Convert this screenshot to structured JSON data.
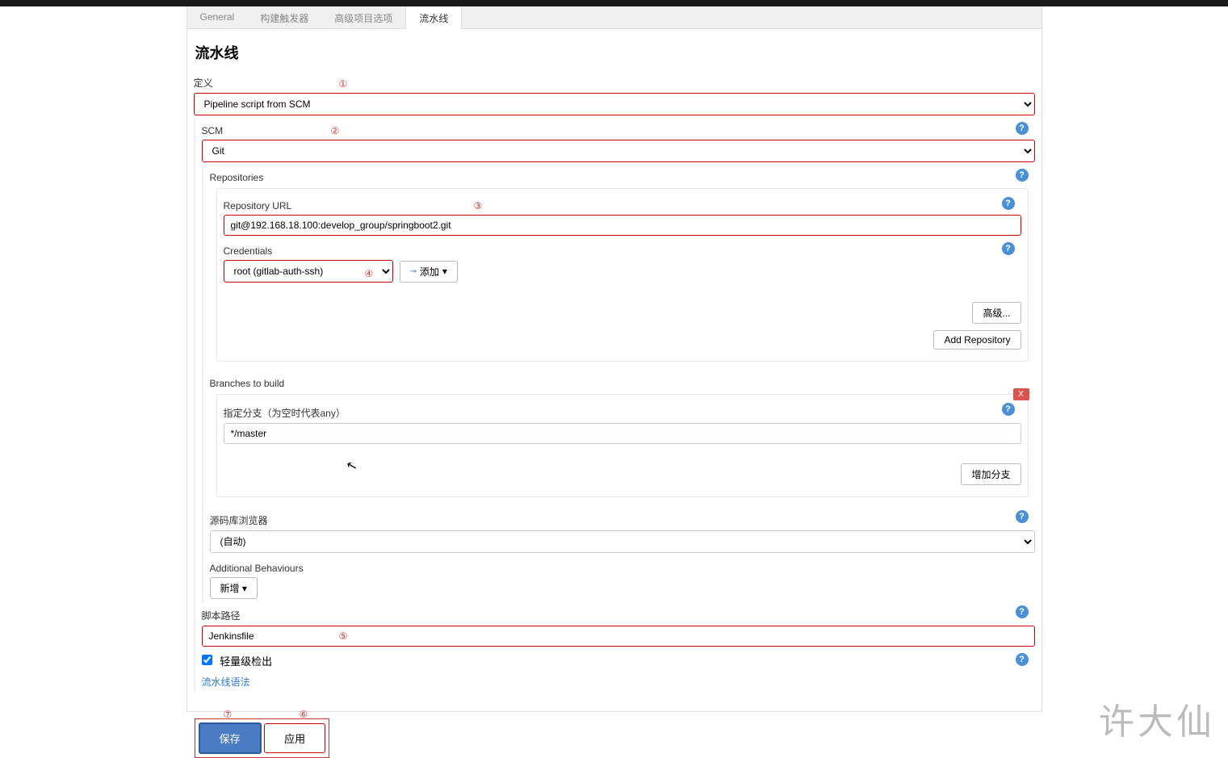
{
  "tabs": {
    "general": "General",
    "triggers": "构建触发器",
    "advanced": "高级项目选项",
    "pipeline": "流水线"
  },
  "section_title": "流水线",
  "annotations": {
    "a1": "①",
    "a2": "②",
    "a3": "③",
    "a4": "④",
    "a5": "⑤",
    "a6": "⑥",
    "a7": "⑦"
  },
  "definition": {
    "label": "定义",
    "value": "Pipeline script from SCM"
  },
  "scm": {
    "label": "SCM",
    "value": "Git"
  },
  "repositories": {
    "label": "Repositories",
    "url_label": "Repository URL",
    "url_value": "git@192.168.18.100:develop_group/springboot2.git",
    "cred_label": "Credentials",
    "cred_value": "root (gitlab-auth-ssh)",
    "add_btn": "添加",
    "advanced_btn": "高级...",
    "add_repo_btn": "Add Repository"
  },
  "branches": {
    "label": "Branches to build",
    "spec_label": "指定分支（为空时代表any）",
    "spec_value": "*/master",
    "add_branch_btn": "增加分支",
    "delete_x": "X"
  },
  "browser": {
    "label": "源码库浏览器",
    "value": "(自动)"
  },
  "behaviours": {
    "label": "Additional Behaviours",
    "add_btn": "新增"
  },
  "script": {
    "label": "脚本路径",
    "value": "Jenkinsfile"
  },
  "lightweight": {
    "label": "轻量级检出"
  },
  "syntax_link": "流水线语法",
  "save_btn": "保存",
  "apply_btn": "应用",
  "watermark": "许大仙"
}
